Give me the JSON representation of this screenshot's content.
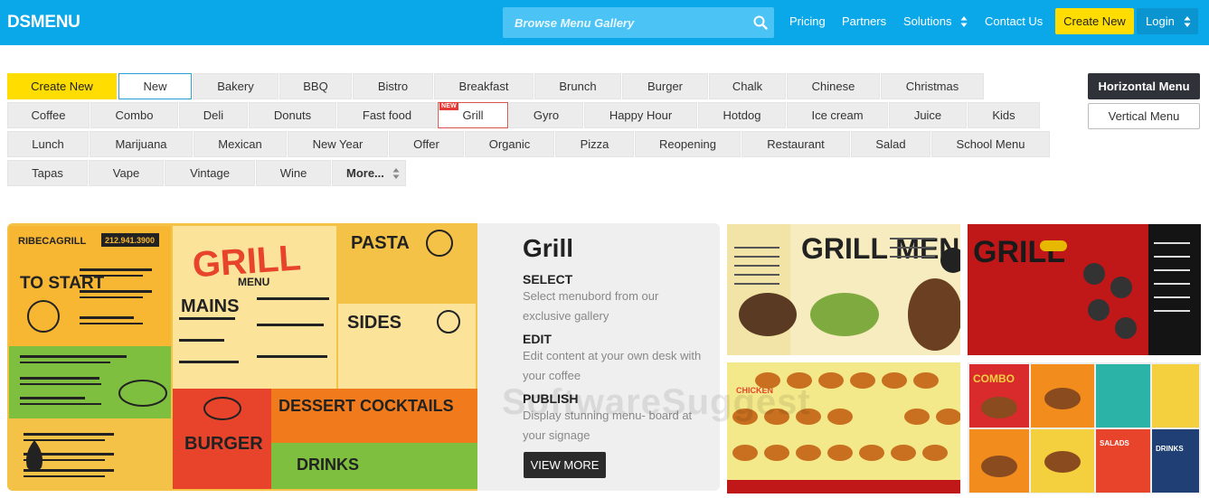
{
  "header": {
    "logo": "DSMENU",
    "search_placeholder": "Browse Menu Gallery",
    "nav": [
      "Pricing",
      "Partners",
      "Solutions",
      "Contact Us"
    ],
    "create_label": "Create New",
    "login_label": "Login"
  },
  "tags": {
    "create": "Create New",
    "row1": [
      "New",
      "Bakery",
      "BBQ",
      "Bistro",
      "Breakfast",
      "Brunch",
      "Burger",
      "Chalk",
      "Chinese",
      "Christmas"
    ],
    "row2": [
      "Coffee",
      "Combo",
      "Deli",
      "Donuts",
      "Fast food",
      "Grill",
      "Gyro",
      "Happy Hour",
      "Hotdog",
      "Ice cream",
      "Juice",
      "Kids"
    ],
    "row3": [
      "Lunch",
      "Marijuana",
      "Mexican",
      "New Year",
      "Offer",
      "Organic",
      "Pizza",
      "Reopening",
      "Restaurant",
      "Salad",
      "School Menu"
    ],
    "row4": [
      "Tapas",
      "Vape",
      "Vintage",
      "Wine"
    ],
    "more": "More...",
    "new_badge": "NEW"
  },
  "layout_buttons": {
    "horizontal": "Horizontal Menu",
    "vertical": "Vertical Menu"
  },
  "feature": {
    "title": "Grill",
    "steps": [
      {
        "heading": "SELECT",
        "text": "Select menubord from our exclusive gallery"
      },
      {
        "heading": "EDIT",
        "text": "Edit content at your own desk with your coffee"
      },
      {
        "heading": "PUBLISH",
        "text": "Display stunning menu- board at your signage"
      }
    ],
    "cta": "VIEW MORE"
  },
  "preview_menu": {
    "restaurant": "RIBECAGRILL",
    "phone": "212.941.3900",
    "title": "GRILL",
    "subtitle": "MENU",
    "sections": [
      "TO START",
      "PASTA",
      "MAINS",
      "SIDES",
      "BURGER",
      "DESSERT COCKTAILS",
      "DRINKS"
    ]
  },
  "gallery_labels": [
    "GRILL MENU",
    "GRILL",
    "COMBO",
    "CHICKEN",
    "SALADS",
    "DRINKS"
  ],
  "watermark": "SoftwareSuggest",
  "colors": {
    "topbar": "#0aa7e9",
    "accent_yellow": "#ffdd00",
    "dark_button": "#2f3238"
  }
}
